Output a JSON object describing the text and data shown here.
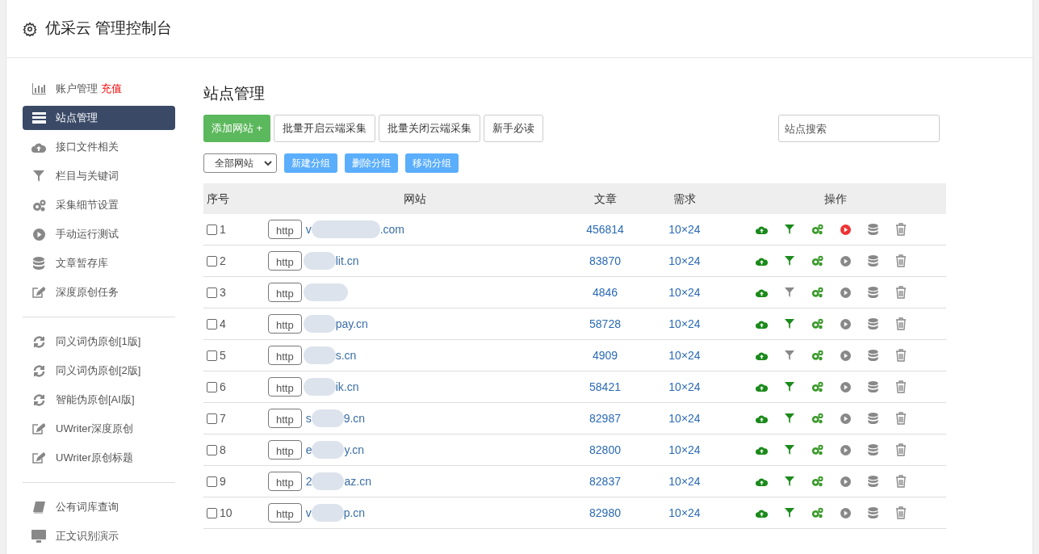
{
  "header": {
    "title": "优采云 管理控制台"
  },
  "sidebar": {
    "groups": [
      {
        "items": [
          {
            "label": "账户管理",
            "badge": "充值",
            "kind": "chart",
            "selected": false
          },
          {
            "label": "站点管理",
            "kind": "list",
            "selected": true
          },
          {
            "label": "接口文件相关",
            "kind": "cloud",
            "selected": false
          },
          {
            "label": "栏目与关键词",
            "kind": "filter",
            "selected": false
          },
          {
            "label": "采集细节设置",
            "kind": "gears",
            "selected": false
          },
          {
            "label": "手动运行测试",
            "kind": "play",
            "selected": false
          },
          {
            "label": "文章暂存库",
            "kind": "db",
            "selected": false
          },
          {
            "label": "深度原创任务",
            "kind": "edit",
            "selected": false
          }
        ]
      },
      {
        "items": [
          {
            "label": "同义词伪原创[1版]",
            "kind": "refresh",
            "selected": false
          },
          {
            "label": "同义词伪原创[2版]",
            "kind": "refresh",
            "selected": false
          },
          {
            "label": "智能伪原创[AI版]",
            "kind": "refresh",
            "selected": false
          },
          {
            "label": "UWriter深度原创",
            "kind": "edit",
            "selected": false
          },
          {
            "label": "UWriter原创标题",
            "kind": "edit",
            "selected": false
          }
        ]
      },
      {
        "items": [
          {
            "label": "公有词库查询",
            "kind": "book",
            "selected": false
          },
          {
            "label": "正文识别演示",
            "kind": "monitor",
            "selected": false
          }
        ]
      }
    ]
  },
  "main": {
    "title": "站点管理",
    "buttons": [
      {
        "label": "添加网站 +",
        "kind": "primary"
      },
      {
        "label": "批量开启云端采集",
        "kind": "default"
      },
      {
        "label": "批量关闭云端采集",
        "kind": "default"
      },
      {
        "label": "新手必读",
        "kind": "default"
      }
    ],
    "search": {
      "placeholder": "站点搜索"
    },
    "group_select": {
      "value": "全部网站"
    },
    "group_buttons": [
      "新建分组",
      "删除分组",
      "移动分组"
    ],
    "table": {
      "columns": [
        "序号",
        "网站",
        "文章",
        "需求",
        "操作"
      ],
      "rows": [
        {
          "number": "1",
          "checked": false,
          "scheme": "http",
          "host_prefix": "v",
          "host_suffix": ".com",
          "articles": "456814",
          "demand": "10×24",
          "filter_on": true,
          "running": true
        },
        {
          "number": "2",
          "checked": false,
          "scheme": "http",
          "host_suffix": "lit.cn",
          "articles": "83870",
          "demand": "10×24",
          "filter_on": true,
          "running": false
        },
        {
          "number": "3",
          "checked": false,
          "scheme": "http",
          "articles": "4846",
          "demand": "10×24",
          "filter_on": false,
          "running": false
        },
        {
          "number": "4",
          "checked": false,
          "scheme": "http",
          "host_suffix": "pay.cn",
          "articles": "58728",
          "demand": "10×24",
          "filter_on": true,
          "running": false
        },
        {
          "number": "5",
          "checked": false,
          "scheme": "http",
          "host_suffix": "s.cn",
          "articles": "4909",
          "demand": "10×24",
          "filter_on": false,
          "running": false
        },
        {
          "number": "6",
          "checked": false,
          "scheme": "http",
          "host_suffix": "ik.cn",
          "articles": "58421",
          "demand": "10×24",
          "filter_on": true,
          "running": false
        },
        {
          "number": "7",
          "checked": false,
          "scheme": "http",
          "host_prefix": "s",
          "host_suffix": "9.cn",
          "articles": "82987",
          "demand": "10×24",
          "filter_on": true,
          "running": false
        },
        {
          "number": "8",
          "checked": false,
          "scheme": "http",
          "host_prefix": "e",
          "host_suffix": "y.cn",
          "articles": "82800",
          "demand": "10×24",
          "filter_on": true,
          "running": false
        },
        {
          "number": "9",
          "checked": false,
          "scheme": "http",
          "host_prefix": "2",
          "host_suffix": "az.cn",
          "articles": "82837",
          "demand": "10×24",
          "filter_on": true,
          "running": false
        },
        {
          "number": "10",
          "checked": false,
          "scheme": "http",
          "host_prefix": "v",
          "host_suffix": "p.cn",
          "articles": "82980",
          "demand": "10×24",
          "filter_on": true,
          "running": false
        }
      ]
    }
  }
}
